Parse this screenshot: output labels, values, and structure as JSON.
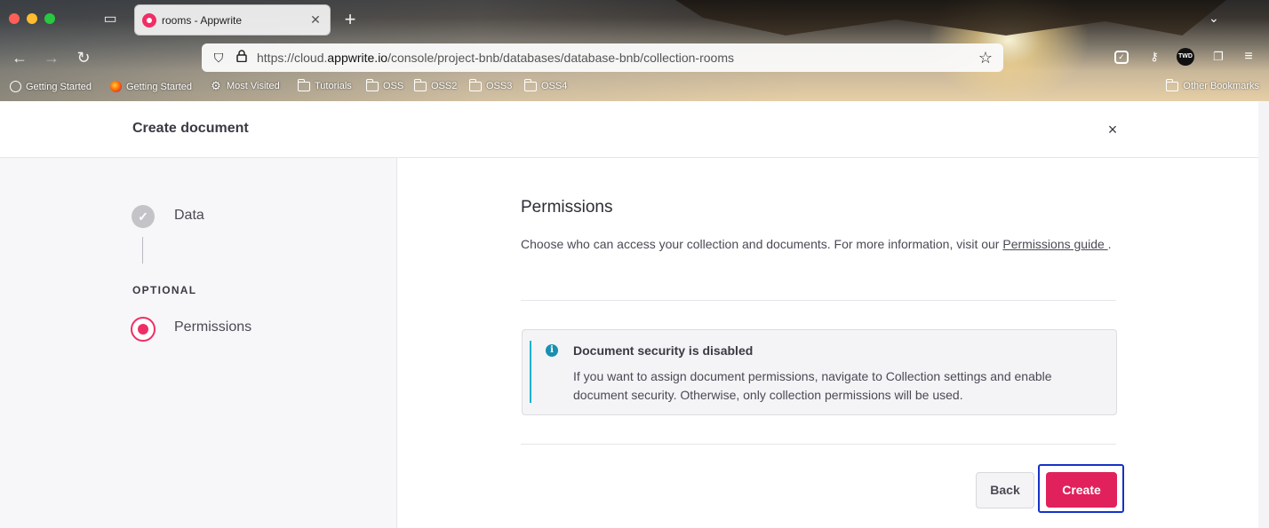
{
  "browser": {
    "tab_title": "rooms - Appwrite",
    "tab_close": "✕",
    "new_tab": "+",
    "url_prefix": "https://cloud.",
    "url_host": "appwrite.io",
    "url_path": "/console/project-bnb/databases/database-bnb/collection-rooms",
    "profile_initials": "TWD",
    "bookmarks": [
      {
        "label": "Getting Started",
        "icon": "globe-icon"
      },
      {
        "label": "Getting Started",
        "icon": "firefox-icon"
      },
      {
        "label": "Most Visited",
        "icon": "gear-icon"
      },
      {
        "label": "Tutorials",
        "icon": "folder-icon"
      },
      {
        "label": "OSS",
        "icon": "folder-icon"
      },
      {
        "label": "OSS2",
        "icon": "folder-icon"
      },
      {
        "label": "OSS3",
        "icon": "folder-icon"
      },
      {
        "label": "OSS4",
        "icon": "folder-icon"
      }
    ],
    "other_bookmarks": "Other Bookmarks",
    "accent_favicon": "#f02e65"
  },
  "modal": {
    "title": "Create document",
    "close_label": "×"
  },
  "steps": {
    "done_check": "✓",
    "data_label": "Data",
    "optional_label": "OPTIONAL",
    "permissions_label": "Permissions"
  },
  "permissions": {
    "title": "Permissions",
    "description": "Choose who can access your collection and documents. For more information, visit our ",
    "guide_link": "Permissions guide ",
    "description_end": "."
  },
  "alert": {
    "icon": "i",
    "title": "Document security is disabled",
    "body": "If you want to assign document permissions, navigate to Collection settings and enable document security. Otherwise, only collection permissions will be used."
  },
  "actions": {
    "back_label": "Back",
    "create_label": "Create"
  },
  "colors": {
    "primary": "#e0215c",
    "info": "#1bb1ce",
    "focus": "#1532c9"
  }
}
